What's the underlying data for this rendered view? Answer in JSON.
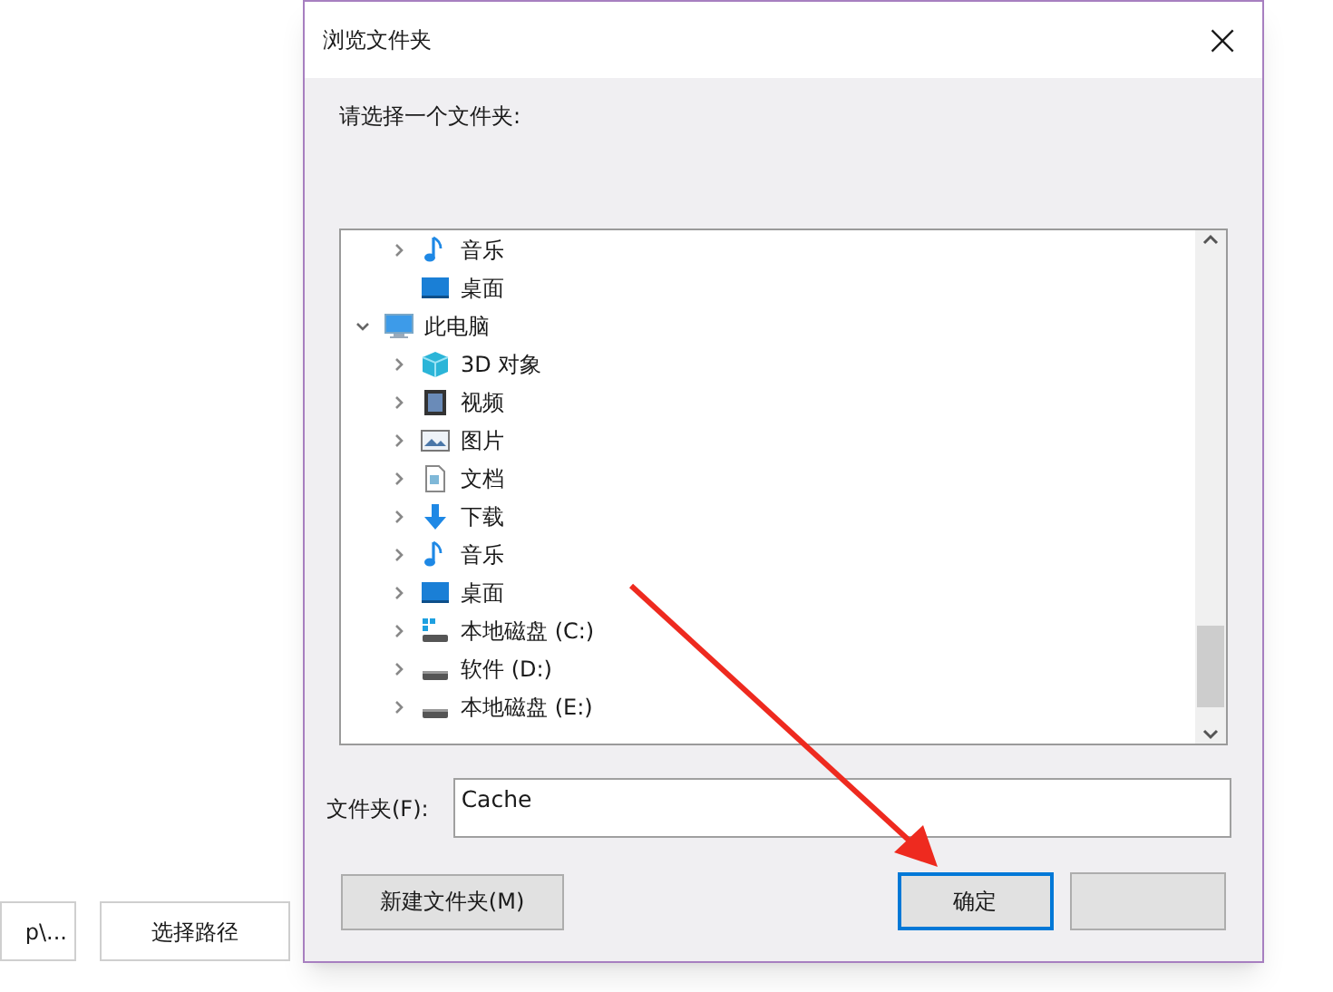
{
  "background": {
    "path_field": {
      "value": "p\\..."
    },
    "choose_path_button": "选择路径"
  },
  "dialog": {
    "title": "浏览文件夹",
    "close": "×",
    "prompt": "请选择一个文件夹:",
    "tree": {
      "scrolled_children": [
        {
          "label": "音乐",
          "kind": "music",
          "expandable": true
        },
        {
          "label": "桌面",
          "kind": "desktop",
          "expandable": false
        }
      ],
      "items": [
        {
          "label": "此电脑",
          "kind": "pc",
          "expandable": true,
          "expanded": true,
          "children": [
            {
              "label": "3D 对象",
              "kind": "cube",
              "expandable": true
            },
            {
              "label": "视频",
              "kind": "video",
              "expandable": true
            },
            {
              "label": "图片",
              "kind": "picture",
              "expandable": true
            },
            {
              "label": "文档",
              "kind": "document",
              "expandable": true
            },
            {
              "label": "下载",
              "kind": "download",
              "expandable": true
            },
            {
              "label": "音乐",
              "kind": "music",
              "expandable": true
            },
            {
              "label": "桌面",
              "kind": "desktop",
              "expandable": true
            },
            {
              "label": "本地磁盘 (C:)",
              "kind": "system-drive",
              "expandable": true
            },
            {
              "label": "软件 (D:)",
              "kind": "drive",
              "expandable": true
            },
            {
              "label": "本地磁盘 (E:)",
              "kind": "drive",
              "expandable": true
            }
          ]
        }
      ]
    },
    "folder_label": "文件夹(F):",
    "folder_field": {
      "value": "Cache"
    },
    "new_folder_button": "新建文件夹(M)",
    "ok_button": {
      "label": "确定",
      "focused": true
    }
  }
}
